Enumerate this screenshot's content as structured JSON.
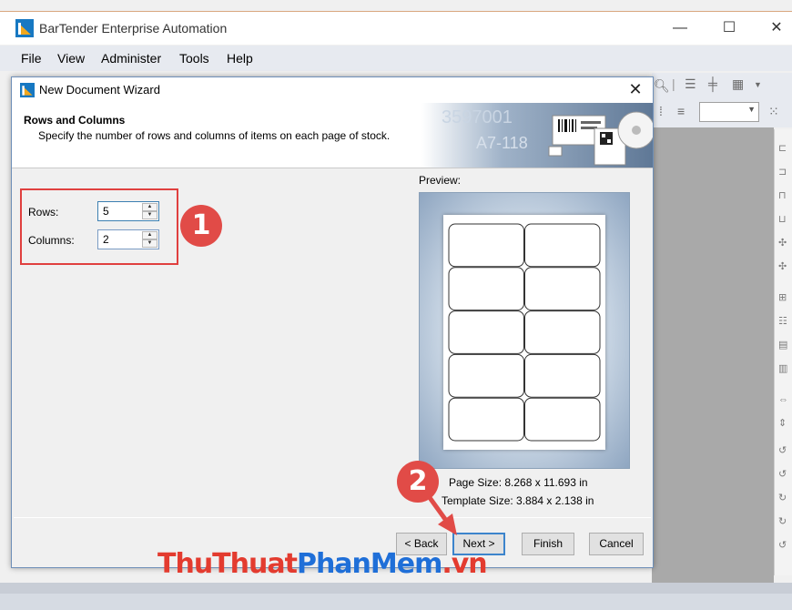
{
  "app": {
    "title": "BarTender Enterprise Automation",
    "minimize": "—",
    "maximize": "☐",
    "close": "✕",
    "accent_color": "#1778c2"
  },
  "menu": {
    "items": [
      "File",
      "View",
      "Administer",
      "Tools",
      "Help"
    ]
  },
  "dialog": {
    "title": "New Document Wizard",
    "close": "✕",
    "header_title": "Rows and Columns",
    "header_subtitle": "Specify the number of rows and columns of items on each page of stock.",
    "banner_text_1": "3597001",
    "banner_text_2": "A7-118",
    "rows_label": "Rows:",
    "rows_value": "5",
    "columns_label": "Columns:",
    "columns_value": "2",
    "preview_label": "Preview:",
    "preview_rows": 5,
    "preview_columns": 2,
    "page_size": "Page Size:  8.268 x 11.693 in",
    "template_size": "Template Size:  3.884 x 2.138 in",
    "buttons": {
      "back": "< Back",
      "next": "Next >",
      "finish": "Finish",
      "cancel": "Cancel"
    }
  },
  "annotations": {
    "badge_1": "1",
    "badge_2": "2",
    "badge_color": "#e14b47"
  },
  "watermark": {
    "part1": "ThuThuat",
    "part2": "PhanMem",
    "part3": ".vn"
  }
}
